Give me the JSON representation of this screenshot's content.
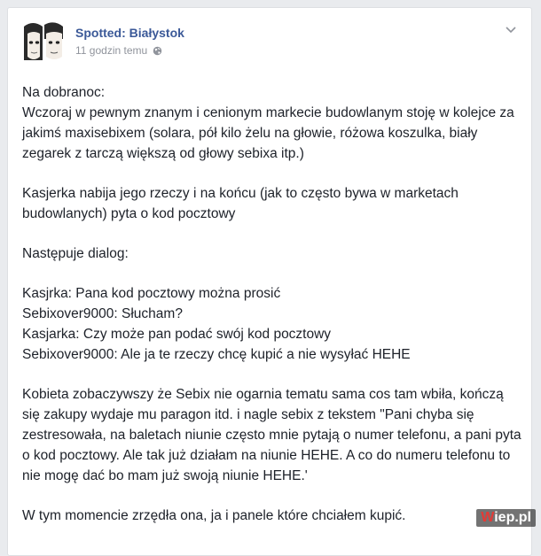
{
  "post": {
    "page_name": "Spotted: Białystok",
    "time": "11 godzin temu",
    "privacy_icon": "globe-icon",
    "menu_icon": "chevron-down-icon",
    "paragraphs": [
      "Na dobranoc:\nWczoraj w pewnym znanym i cenionym markecie budowlanym stoję w kolejce za jakimś maxisebixem (solara, pół kilo żelu na głowie, różowa koszulka, biały zegarek z tarczą większą od głowy sebixa itp.)",
      "Kasjerka nabija jego rzeczy i na końcu (jak to często bywa w marketach budowlanych) pyta o kod pocztowy",
      "Następuje dialog:",
      "Kasjrka: Pana kod pocztowy można prosić\nSebixover9000: Słucham?\nKasjarka: Czy może pan podać swój kod pocztowy\nSebixover9000: Ale ja te rzeczy chcę kupić a nie wysyłać HEHE",
      "Kobieta zobaczywszy że Sebix nie ogarnia tematu sama cos tam wbiła, kończą się zakupy wydaje mu paragon itd. i nagle sebix z tekstem \"Pani chyba się zestresowała, na baletach niunie często mnie pytają o numer telefonu, a pani pyta o kod pocztowy. Ale tak już działam na niunie HEHE. A co do numeru telefonu to nie mogę dać bo mam już swoją niunie HEHE.'",
      "W tym momencie zrzędła ona, ja i panele które chciałem kupić."
    ]
  },
  "watermark": {
    "prefix": "W",
    "rest": "iep.pl"
  }
}
